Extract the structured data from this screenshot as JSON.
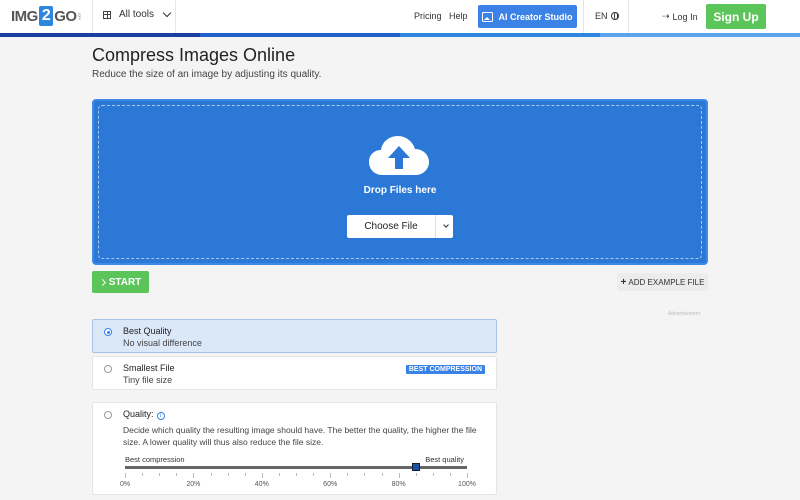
{
  "header": {
    "logo": {
      "left": "IMG",
      "mid": "2",
      "right": "GO",
      "suffix": ".com"
    },
    "all_tools": "All tools",
    "pricing": "Pricing",
    "help": "Help",
    "ai_creator": "AI Creator Studio",
    "language": "EN",
    "login": "Log In",
    "signup": "Sign Up",
    "bar_colors": [
      "#1c3fa0",
      "#2060c8",
      "#2e86de",
      "#5aa4ee"
    ]
  },
  "page": {
    "title": "Compress Images Online",
    "subtitle": "Reduce the size of an image by adjusting its quality."
  },
  "dropzone": {
    "drop_text": "Drop Files here",
    "choose_file": "Choose File"
  },
  "actions": {
    "start": "START",
    "add_example": "ADD EXAMPLE FILE",
    "advertisement": "Advertisement"
  },
  "options": [
    {
      "title": "Best Quality",
      "subtitle": "No visual difference",
      "selected": true
    },
    {
      "title": "Smallest File",
      "subtitle": "Tiny file size",
      "badge": "BEST COMPRESSION",
      "selected": false
    },
    {
      "title": "Quality:",
      "description": "Decide which quality the resulting image should have. The better the quality, the higher the file size. A lower quality will thus also reduce the file size.",
      "selected": false,
      "slider": {
        "min_label": "Best compression",
        "max_label": "Best quality",
        "value_percent": 85,
        "tick_labels": [
          "0%",
          "20%",
          "40%",
          "60%",
          "80%",
          "100%"
        ]
      }
    }
  ],
  "colors": {
    "primary": "#2b78d6",
    "accent": "#3b82e6",
    "success": "#5cc55a"
  }
}
